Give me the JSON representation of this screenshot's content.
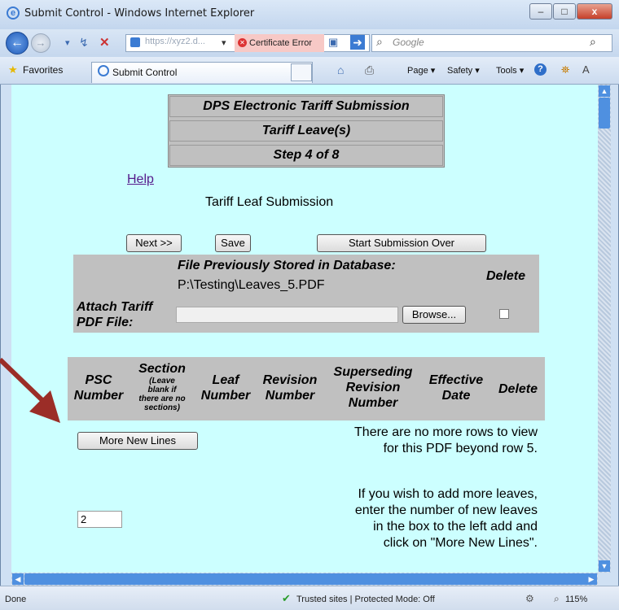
{
  "window": {
    "title": "Submit Control - Windows Internet Explorer",
    "controls": {
      "minimize": "–",
      "maximize": "□",
      "close": "x"
    }
  },
  "navbar": {
    "address_url": "https://xyz2.d...",
    "certificate_error": "Certificate Error",
    "search_placeholder": "Google"
  },
  "cmdbar": {
    "favorites": "Favorites",
    "tab_title": "Submit Control",
    "page": "Page ▾",
    "safety": "Safety ▾",
    "tools": "Tools ▾"
  },
  "header": {
    "title": "DPS Electronic Tariff Submission",
    "section": "Tariff Leave(s)",
    "step": "Step 4 of 8"
  },
  "help_link": "Help",
  "subtitle": "Tariff Leaf Submission",
  "buttons": {
    "next": "Next >>",
    "save": "Save",
    "start_over": "Start Submission Over",
    "browse": "Browse...",
    "more_lines": "More New Lines"
  },
  "file_section": {
    "stored_label": "File Previously Stored in Database:",
    "stored_path": "P:\\Testing\\Leaves_5.PDF",
    "delete_label": "Delete",
    "attach_label_line1": "Attach Tariff",
    "attach_label_line2": "PDF File:"
  },
  "table": {
    "columns": {
      "psc_number": [
        "PSC",
        "Number"
      ],
      "section": "Section",
      "section_note": [
        "(Leave",
        "blank if",
        "there are no",
        "sections)"
      ],
      "leaf_number": [
        "Leaf",
        "Number"
      ],
      "revision_number": [
        "Revision",
        "Number"
      ],
      "superseding": [
        "Superseding",
        "Revision",
        "Number"
      ],
      "effective_date": [
        "Effective",
        "Date"
      ],
      "delete": "Delete"
    }
  },
  "messages": {
    "no_more_rows": [
      "There are no more rows to view",
      "for this PDF beyond row 5."
    ],
    "add_more": [
      "If you wish to add more leaves,",
      "enter the number of new leaves",
      "in the box to the left add and",
      "click on \"More New Lines\"."
    ]
  },
  "new_lines_value": "2",
  "status": {
    "done": "Done",
    "zone": "Trusted sites | Protected Mode: Off",
    "zoom": "115%"
  },
  "annotation_arrow_color": "#9b2d27"
}
